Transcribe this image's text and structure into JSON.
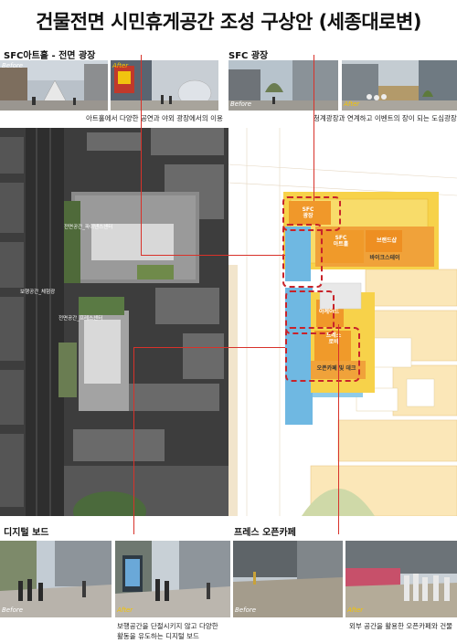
{
  "title": "건물전면 시민휴게공간 조성 구상안 (세종대로변)",
  "sections": {
    "sfc_hall": {
      "label": "SFC아트홀 - 전면 광장",
      "caption": "아트홀에서 다양한 공연과 야외 광장에서의 이용",
      "before": "Before",
      "after": "After"
    },
    "sfc_plaza": {
      "label": "SFC 광장",
      "caption": "청계광장과 연계하고 이벤트의 장이 되는 도심광장",
      "before": "Before",
      "after": "After"
    },
    "digital_board": {
      "label": "디지털 보드",
      "caption_line1": "보행공간을 단절시키지 않고 다양한",
      "caption_line2": "활동을 유도하는 디지털 보드",
      "before": "Before",
      "after": "After"
    },
    "open_cafe": {
      "label": "프레스 오픈카페",
      "caption": "외부 공간을 활용한 오픈카페와 건물",
      "before": "Before",
      "after": "After"
    }
  },
  "aerial_map": {
    "labels": [
      "전면공간_파이낸스센터",
      "보행공간_체험광",
      "전면공간_프레스센터"
    ]
  },
  "plan_map": {
    "labels": {
      "sfc_plaza": "SFC\n광장",
      "sfc_arthall": "SFC\n아트홀",
      "brand_shop": "브랜드샵",
      "bike_station": "바이크스테이",
      "arcade": "아케이드",
      "press_lobby": "프레스\n로비",
      "open_cafe": "오픈카페 및 데크"
    }
  },
  "colors": {
    "accent_red": "#d8322a",
    "plan_yellow": "#f7d24a",
    "plan_orange": "#f0982a",
    "plan_blue": "#6fb8e2"
  }
}
